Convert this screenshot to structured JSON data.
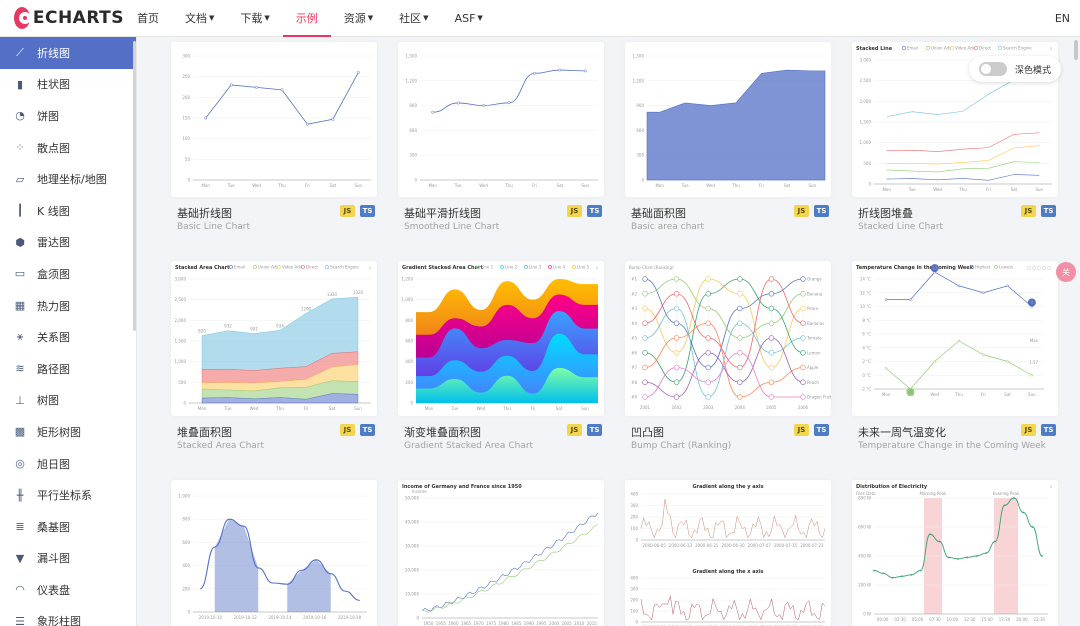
{
  "nav": {
    "logo": "ECHARTS",
    "items": [
      {
        "label": "首页",
        "caret": false
      },
      {
        "label": "文档",
        "caret": true
      },
      {
        "label": "下载",
        "caret": true
      },
      {
        "label": "示例",
        "caret": false,
        "active": true
      },
      {
        "label": "资源",
        "caret": true
      },
      {
        "label": "社区",
        "caret": true
      },
      {
        "label": "ASF",
        "caret": true
      }
    ],
    "lang": "EN"
  },
  "sidebar": {
    "items": [
      {
        "label": "折线图",
        "icon": "line-chart-icon",
        "glyph": "⟋",
        "active": true
      },
      {
        "label": "柱状图",
        "icon": "bar-chart-icon",
        "glyph": "▮"
      },
      {
        "label": "饼图",
        "icon": "pie-chart-icon",
        "glyph": "◔"
      },
      {
        "label": "散点图",
        "icon": "scatter-icon",
        "glyph": "⁘"
      },
      {
        "label": "地理坐标/地图",
        "icon": "map-icon",
        "glyph": "▱"
      },
      {
        "label": "K 线图",
        "icon": "candlestick-icon",
        "glyph": "┃"
      },
      {
        "label": "雷达图",
        "icon": "radar-icon",
        "glyph": "⬢"
      },
      {
        "label": "盒须图",
        "icon": "boxplot-icon",
        "glyph": "▭"
      },
      {
        "label": "热力图",
        "icon": "heatmap-icon",
        "glyph": "▦"
      },
      {
        "label": "关系图",
        "icon": "graph-icon",
        "glyph": "⚹"
      },
      {
        "label": "路径图",
        "icon": "lines-icon",
        "glyph": "≋"
      },
      {
        "label": "树图",
        "icon": "tree-icon",
        "glyph": "⊥"
      },
      {
        "label": "矩形树图",
        "icon": "treemap-icon",
        "glyph": "▩"
      },
      {
        "label": "旭日图",
        "icon": "sunburst-icon",
        "glyph": "◎"
      },
      {
        "label": "平行坐标系",
        "icon": "parallel-icon",
        "glyph": "╫"
      },
      {
        "label": "桑基图",
        "icon": "sankey-icon",
        "glyph": "≣"
      },
      {
        "label": "漏斗图",
        "icon": "funnel-icon",
        "glyph": "▼"
      },
      {
        "label": "仪表盘",
        "icon": "gauge-icon",
        "glyph": "◠"
      },
      {
        "label": "象形柱图",
        "icon": "pictorial-bar-icon",
        "glyph": "☰"
      }
    ]
  },
  "dark_mode": {
    "label": "深色模式"
  },
  "float_button": {
    "label": "关"
  },
  "cards": [
    {
      "title": "基础折线图",
      "subtitle": "Basic Line Chart",
      "js": "JS",
      "ts": "TS"
    },
    {
      "title": "基础平滑折线图",
      "subtitle": "Smoothed Line Chart",
      "js": "JS",
      "ts": "TS"
    },
    {
      "title": "基础面积图",
      "subtitle": "Basic area chart",
      "js": "JS",
      "ts": "TS"
    },
    {
      "title": "折线图堆叠",
      "subtitle": "Stacked Line Chart",
      "js": "JS",
      "ts": "TS"
    },
    {
      "title": "堆叠面积图",
      "subtitle": "Stacked Area Chart",
      "js": "JS",
      "ts": "TS"
    },
    {
      "title": "渐变堆叠面积图",
      "subtitle": "Gradient Stacked Area Chart",
      "js": "JS",
      "ts": "TS"
    },
    {
      "title": "凹凸图",
      "subtitle": "Bump Chart (Ranking)",
      "js": "JS",
      "ts": "TS"
    },
    {
      "title": "未来一周气温变化",
      "subtitle": "Temperature Change in the Coming Week",
      "js": "JS",
      "ts": "TS"
    },
    {
      "title": "",
      "subtitle": "",
      "js": "",
      "ts": ""
    },
    {
      "title": "",
      "subtitle": "",
      "js": "",
      "ts": ""
    },
    {
      "title": "",
      "subtitle": "",
      "js": "",
      "ts": ""
    },
    {
      "title": "",
      "subtitle": "",
      "js": "",
      "ts": ""
    }
  ],
  "thumbs": {
    "basic_line": {
      "days": [
        "Mon",
        "Tue",
        "Wed",
        "Thu",
        "Fri",
        "Sat",
        "Sun"
      ],
      "values": [
        150,
        230,
        224,
        218,
        135,
        147,
        260
      ],
      "yticks": [
        "0",
        "50",
        "100",
        "150",
        "200",
        "250",
        "300"
      ]
    },
    "smooth_line": {
      "days": [
        "Mon",
        "Tue",
        "Wed",
        "Thu",
        "Fri",
        "Sat",
        "Sun"
      ],
      "values": [
        820,
        932,
        901,
        934,
        1290,
        1330,
        1320
      ],
      "yticks": [
        "0",
        "300",
        "600",
        "900",
        "1,200",
        "1,500"
      ]
    },
    "basic_area": {
      "days": [
        "Mon",
        "Tue",
        "Wed",
        "Thu",
        "Fri",
        "Sat",
        "Sun"
      ],
      "values": [
        820,
        932,
        901,
        934,
        1290,
        1330,
        1320
      ],
      "yticks": [
        "0",
        "300",
        "600",
        "900",
        "1,200",
        "1,500"
      ]
    },
    "stacked_line": {
      "title": "Stacked Line",
      "legend": [
        "Email",
        "Union Ads",
        "Video Ads",
        "Direct",
        "Search Engine"
      ],
      "days": [
        "Mon",
        "Tue",
        "Wed",
        "Thu",
        "Fri",
        "Sat",
        "Sun"
      ],
      "yticks": [
        "0",
        "500",
        "1,000",
        "1,500",
        "2,000",
        "2,500",
        "3,000"
      ]
    },
    "stacked_area": {
      "title": "Stacked Area Chart",
      "legend": [
        "Email",
        "Union Ads",
        "Video Ads",
        "Direct",
        "Search Engine"
      ],
      "days": [
        "Mon",
        "Tue",
        "Wed",
        "Thu",
        "Fri",
        "Sat",
        "Sun"
      ],
      "top_labels": [
        "820",
        "932",
        "901",
        "934",
        "1290",
        "1330",
        "1320"
      ],
      "yticks": [
        "0",
        "500",
        "1,000",
        "1,500",
        "2,000",
        "2,500",
        "3,000"
      ]
    },
    "gradient_area": {
      "title": "Gradient Stacked Area Chart",
      "legend": [
        "Line 1",
        "Line 2",
        "Line 3",
        "Line 4",
        "Line 5"
      ],
      "days": [
        "Mon",
        "Tue",
        "Wed",
        "Thu",
        "Fri",
        "Sat",
        "Sun"
      ],
      "yticks": [
        "0",
        "200",
        "400",
        "600",
        "800",
        "1,000",
        "1,200"
      ]
    },
    "bump": {
      "title": "Bump Chart (Ranking)",
      "ranks": [
        "#1",
        "#2",
        "#3",
        "#4",
        "#5",
        "#6",
        "#7",
        "#8",
        "#9"
      ],
      "years": [
        "2001",
        "2002",
        "2003",
        "2004",
        "2005",
        "2006"
      ],
      "fruits": [
        "Orange",
        "Banana",
        "Pears",
        "Bananas",
        "Tomato",
        "Lemon",
        "Apple",
        "Peach",
        "Dragon Fruit"
      ]
    },
    "temperature": {
      "title": "Temperature Change in the Coming Week",
      "legend": [
        "Highest",
        "Lowest"
      ],
      "days": [
        "Mon",
        "Tue",
        "Wed",
        "Thu",
        "Fri",
        "Sat",
        "Sun"
      ],
      "yticks": [
        "-2 °C",
        "0 °C",
        "2 °C",
        "4 °C",
        "6 °C",
        "8 °C",
        "10 °C",
        "12 °C",
        "14 °C"
      ],
      "labels": [
        "13",
        "9",
        "Max",
        "-2",
        "1.57"
      ]
    },
    "area_pieces": {
      "dates": [
        "2019-10-10",
        "2019-10-12",
        "2019-10-14",
        "2019-10-16",
        "2019-10-18"
      ],
      "yticks": [
        "0",
        "200",
        "400",
        "600",
        "800",
        "1,000"
      ]
    },
    "income": {
      "title": "Income of Germany and France since 1950",
      "ylabel": "Income",
      "years": [
        "1950",
        "1955",
        "1960",
        "1965",
        "1970",
        "1975",
        "1980",
        "1985",
        "1990",
        "1995",
        "2000",
        "2005",
        "2010",
        "2015"
      ],
      "yticks": [
        "0",
        "10,000",
        "20,000",
        "30,000",
        "40,000",
        "50,000"
      ]
    },
    "gradient_axis": {
      "title_y": "Gradient along the y axis",
      "title_x": "Gradient along the x axis",
      "dates": [
        "2000-06-05",
        "2000-06-13",
        "2000-06-21",
        "2000-06-30",
        "2000-07-07",
        "2000-07-15",
        "2000-07-23"
      ]
    },
    "electricity": {
      "title": "Distribution of Electricity",
      "ylabel": "Files Data",
      "marks": [
        "Morning Peak",
        "Evening Peak"
      ],
      "yticks": [
        "0 W",
        "200 W",
        "400 W",
        "600 W",
        "800 W"
      ],
      "times": [
        "00:00",
        "02:30",
        "05:00",
        "07:30",
        "10:00",
        "12:30",
        "15:00",
        "17:30",
        "20:00",
        "22:30"
      ]
    }
  },
  "colors": {
    "accent": "#e43961",
    "primary": "#5470c6",
    "series": [
      "#5470c6",
      "#91cc75",
      "#fac858",
      "#ee6666",
      "#73c0de",
      "#3ba272",
      "#fc8452",
      "#9a60b4",
      "#ea7ccc"
    ]
  }
}
